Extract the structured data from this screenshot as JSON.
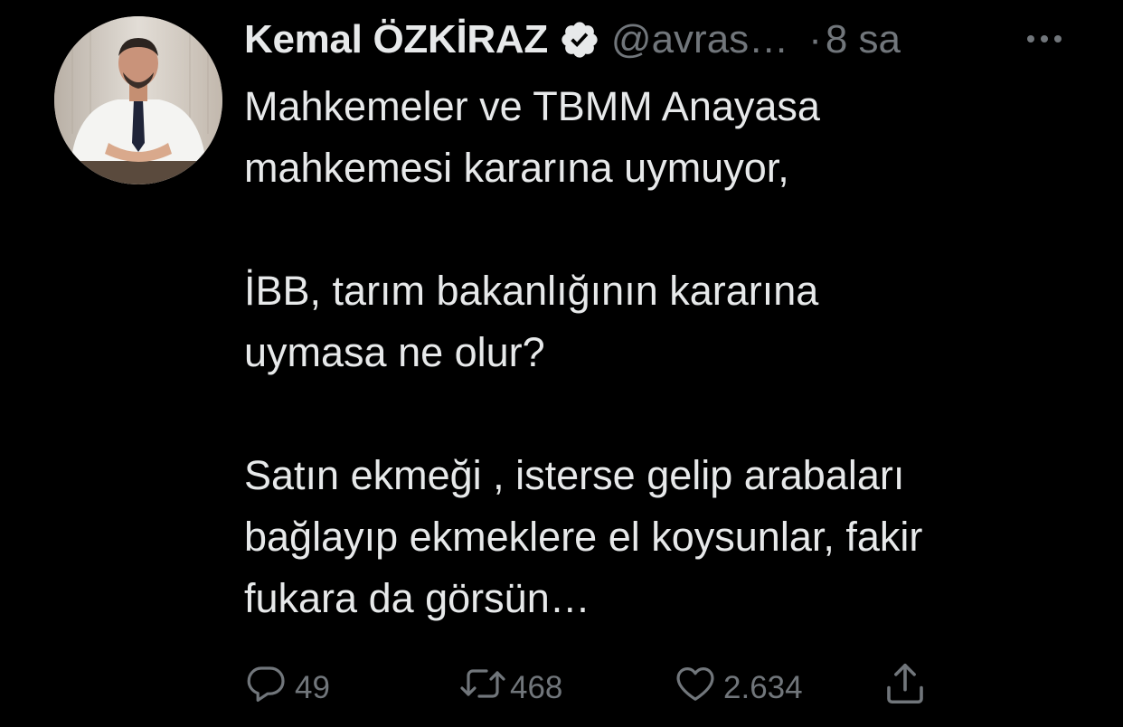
{
  "tweet": {
    "author": {
      "display_name": "Kemal ÖZKİRAZ",
      "verified": true,
      "handle": "@avras…",
      "avatar": "profile-photo"
    },
    "separator": "·",
    "time": "8 sa",
    "more_icon": "more-horizontal-icon",
    "paragraphs": [
      {
        "lines": [
          "Mahkemeler ve TBMM Anayasa",
          "mahkemesi kararına uymuyor,"
        ]
      },
      {
        "lines": [
          "İBB, tarım bakanlığının kararına",
          "uymasa ne olur?"
        ]
      },
      {
        "lines": [
          "Satın ekmeği , isterse gelip arabaları",
          "bağlayıp ekmeklere el koysunlar, fakir",
          "fukara da görsün…"
        ]
      }
    ],
    "actions": {
      "reply": {
        "icon": "reply-icon",
        "count": "49"
      },
      "retweet": {
        "icon": "retweet-icon",
        "count": "468"
      },
      "like": {
        "icon": "heart-icon",
        "count": "2.634"
      },
      "share": {
        "icon": "share-icon"
      }
    }
  },
  "colors": {
    "background": "#000000",
    "text": "#e7e9ea",
    "secondary": "#71767b"
  }
}
